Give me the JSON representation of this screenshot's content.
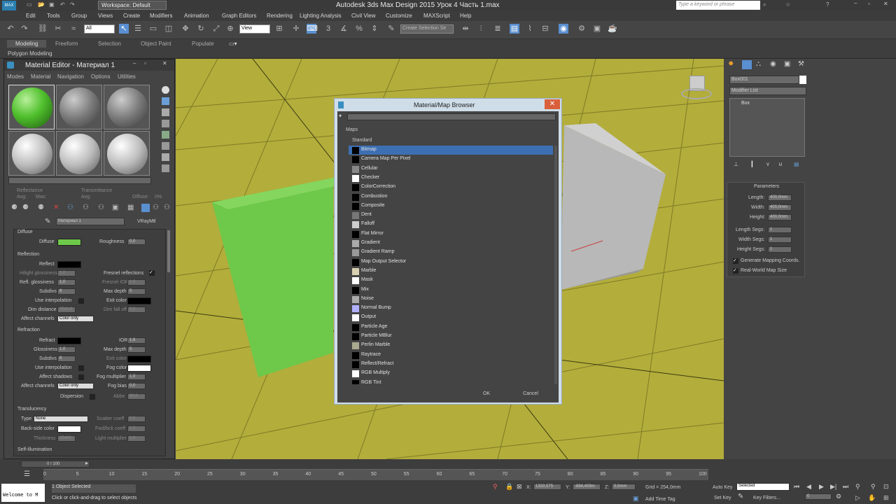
{
  "app": {
    "title": "Autodesk 3ds Max Design 2015     Урок 4 Часть 1.max",
    "workspace": "Workspace: Default",
    "search_placeholder": "Type a keyword or phrase"
  },
  "menu": [
    "Edit",
    "Tools",
    "Group",
    "Views",
    "Create",
    "Modifiers",
    "Animation",
    "Graph Editors",
    "Rendering",
    "Lighting Analysis",
    "Civil View",
    "Customize",
    "MAXScript",
    "Help"
  ],
  "toolbar": {
    "filter": "All",
    "view": "View",
    "selection_set": "Create Selection Se"
  },
  "ribbon": {
    "tabs": [
      "Modeling",
      "Freeform",
      "Selection",
      "Object Paint",
      "Populate"
    ],
    "sub": "Polygon Modeling"
  },
  "material_editor": {
    "title": "Material Editor - Материал 1",
    "menu": [
      "Modes",
      "Material",
      "Navigation",
      "Options",
      "Utilities"
    ],
    "reflectance": "Reflectance",
    "avg1": "Avg:",
    "max1": "Max:",
    "transmittance": "Transmittance",
    "avg2": "Avg:",
    "diffuse_stat": "Diffuse:",
    "pct": "0%",
    "material_name": "Материал 1",
    "material_type": "VRayMtl",
    "sections": {
      "diffuse": "Diffuse",
      "reflection": "Reflection",
      "refraction": "Refraction",
      "translucency": "Translucency",
      "selfillum": "Self-illumination"
    },
    "labels": {
      "diffuse": "Diffuse",
      "roughness": "Roughness",
      "roughness_val": "0,0",
      "reflect": "Reflect",
      "hilight": "Hilight glossiness",
      "hilight_val": "1,0",
      "fresnel": "Fresnel reflections",
      "refl_gloss": "Refl. glossiness",
      "refl_gloss_val": "1,0",
      "fresnel_ior": "Fresnel IOR",
      "fresnel_ior_val": "1,6",
      "subdivs": "Subdivs",
      "subdivs_val": "8",
      "max_depth": "Max depth",
      "max_depth_val": "5",
      "use_interp": "Use interpolation",
      "exit_color": "Exit color",
      "dim_dist": "Dim distance",
      "dim_val": "2540,0",
      "dim_falloff": "Dim fall off",
      "dim_falloff_val": "0,0",
      "affect_channels": "Affect channels",
      "color_only": "Color only",
      "refract": "Refract",
      "ior": "IOR",
      "ior_val": "1,6",
      "glossiness": "Glossiness",
      "glossiness_val": "1,0",
      "subdivs2_val": "8",
      "max_depth2_val": "5",
      "exit_color2": "Exit color",
      "use_interp2": "Use interpolation",
      "fog_color": "Fog color",
      "affect_shadows": "Affect shadows",
      "fog_mult": "Fog multiplier",
      "fog_mult_val": "1,0",
      "affect_channels2": "Affect channels",
      "color_only2": "Color only",
      "fog_bias": "Fog bias",
      "fog_bias_val": "0,0",
      "dispersion": "Dispersion",
      "abbe": "Abbe",
      "abbe_val": "50,0",
      "type": "Type",
      "type_val": "None",
      "scatter": "Scatter coeff",
      "scatter_val": "0,0",
      "back_side": "Back-side color",
      "fwd_bck": "Fwd/bck coeff",
      "fwd_val": "1,0",
      "thickness": "Thickness",
      "thickness_val": "25400",
      "light_mult": "Light multiplier",
      "light_val": "1,0"
    }
  },
  "dialog": {
    "title": "Material/Map Browser",
    "group": "Maps",
    "subgroup": "Standard",
    "items": [
      {
        "name": "Bitmap",
        "icon": "#000000"
      },
      {
        "name": "Camera Map Per Pixel",
        "icon": "#000000"
      },
      {
        "name": "Cellular",
        "icon": "#888888"
      },
      {
        "name": "Checker",
        "icon": "#ffffff"
      },
      {
        "name": "ColorCorrection",
        "icon": "#000000"
      },
      {
        "name": "Combustion",
        "icon": "#000000"
      },
      {
        "name": "Composite",
        "icon": "#000000"
      },
      {
        "name": "Dent",
        "icon": "#777777"
      },
      {
        "name": "Falloff",
        "icon": "#cccccc"
      },
      {
        "name": "Flat Mirror",
        "icon": "#000000"
      },
      {
        "name": "Gradient",
        "icon": "#aaaaaa"
      },
      {
        "name": "Gradient Ramp",
        "icon": "#999999"
      },
      {
        "name": "Map Output Selector",
        "icon": "#000000"
      },
      {
        "name": "Marble",
        "icon": "#d8d0b0"
      },
      {
        "name": "Mask",
        "icon": "#ffffff"
      },
      {
        "name": "Mix",
        "icon": "#000000"
      },
      {
        "name": "Noise",
        "icon": "#aaaaaa"
      },
      {
        "name": "Normal Bump",
        "icon": "#b0b0ff"
      },
      {
        "name": "Output",
        "icon": "#ffffff"
      },
      {
        "name": "Particle Age",
        "icon": "#000000"
      },
      {
        "name": "Particle MBlur",
        "icon": "#000000"
      },
      {
        "name": "Perlin Marble",
        "icon": "#aaa890"
      },
      {
        "name": "Raytrace",
        "icon": "#000000"
      },
      {
        "name": "Reflect/Refract",
        "icon": "#000000"
      },
      {
        "name": "RGB Multiply",
        "icon": "#ffffff"
      },
      {
        "name": "RGB Tint",
        "icon": "#000000"
      }
    ],
    "ok": "OK",
    "cancel": "Cancel"
  },
  "right_panel": {
    "object_name": "Box001",
    "modifier_list": "Modifier List",
    "stack_item": "Box",
    "parameters": "Parameters",
    "length_label": "Length:",
    "length": "400,0mm",
    "width_label": "Width:",
    "width": "400,0mm",
    "height_label": "Height:",
    "height": "400,0mm",
    "length_segs_label": "Length Segs:",
    "length_segs": "1",
    "width_segs_label": "Width Segs:",
    "width_segs": "1",
    "height_segs_label": "Height Segs:",
    "height_segs": "1",
    "gen_coords": "Generate Mapping Coords.",
    "real_world": "Real-World Map Size"
  },
  "timeline": {
    "frame": "0 / 100",
    "ticks": [
      "0",
      "5",
      "10",
      "15",
      "20",
      "25",
      "30",
      "35",
      "40",
      "45",
      "50",
      "55",
      "60",
      "65",
      "70",
      "75",
      "80",
      "85",
      "90",
      "95",
      "100"
    ],
    "welcome": "Welcome to M",
    "status1": "1 Object Selected",
    "status2": "Click or click-and-drag to select objects",
    "x": "1333,575",
    "y": "-684,409m",
    "z": "0,0mm",
    "grid": "Grid = 254,0mm",
    "auto_key": "Auto Key",
    "selected": "Selected",
    "set_key": "Set Key",
    "key_filters": "Key Filters...",
    "add_time_tag": "Add Time Tag",
    "frame_num": "0"
  },
  "colors": {
    "grid": "#b3ad3b",
    "box_green": "#6ec84a",
    "accent": "#3d6fb3"
  }
}
